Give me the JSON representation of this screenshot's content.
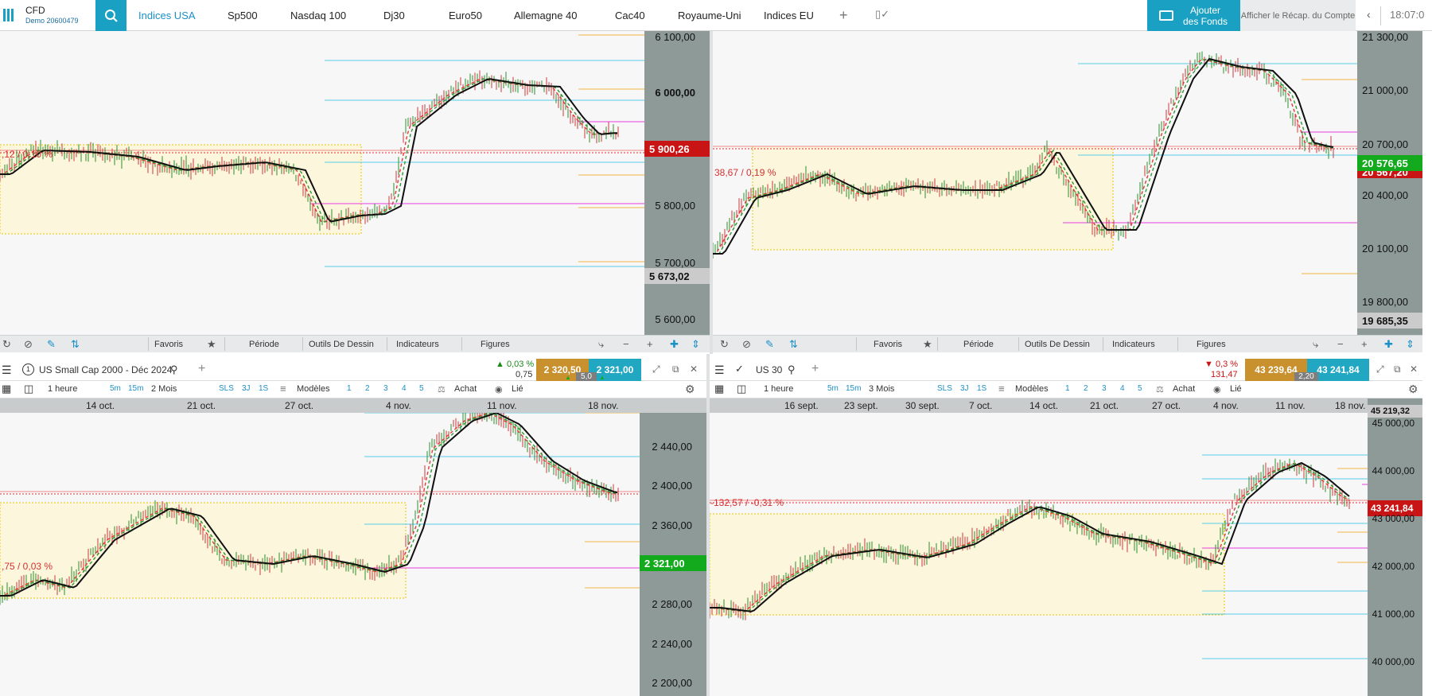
{
  "header": {
    "account_type": "CFD",
    "account_number": "Demo 20600479",
    "tabs": [
      "Indices USA",
      "Sp500",
      "Nasdaq 100",
      "Dj30",
      "Euro50",
      "Allemagne 40",
      "Cac40",
      "Royaume-Uni",
      "Indices EU"
    ],
    "add_funds_line1": "Ajouter",
    "add_funds_line2": "des Fonds",
    "account_summary": "Afficher le Récap. du Compte",
    "clock": "18:07:0"
  },
  "toolbar": {
    "favoris": "Favoris",
    "periode": "Période",
    "outils": "Outils De Dessin",
    "indicateurs": "Indicateurs",
    "figures": "Figures"
  },
  "charts": {
    "sp500": {
      "y_labels": [
        "6 100,00",
        "6 000,00",
        "5 800,00",
        "5 700,00",
        "5 600,00"
      ],
      "last_price": "5 900,26",
      "low_price": "5 673,02",
      "change_label": ",12 / 0,10 %"
    },
    "dj_top": {
      "y_labels": [
        "21 300,00",
        "21 000,00",
        "20 700,00",
        "20 400,00",
        "20 100,00",
        "19 800,00"
      ],
      "last_price": "20 576,65",
      "hidden_price": "20 567,20",
      "low_price": "19 685,35",
      "change_label": "38,67 / 0,19 %"
    },
    "russell": {
      "title": "US Small Cap 2000 - Déc 2024",
      "change_pct": "0,03 %",
      "change_abs": "0,75",
      "sell": "2 320,50",
      "buy": "2 321,00",
      "spread": "5,0",
      "timeframe": "1 heure",
      "period": "2 Mois",
      "modeles": "Modèles",
      "achat": "Achat",
      "lie": "Lié",
      "tf_buttons": [
        "5m",
        "15m"
      ],
      "range_buttons": [
        "SLS",
        "3J",
        "1S"
      ],
      "num_buttons": [
        "1",
        "2",
        "3",
        "4",
        "5"
      ],
      "dates": [
        "14 oct.",
        "21 oct.",
        "27 oct.",
        "4 nov.",
        "11 nov.",
        "18 nov."
      ],
      "y_labels": [
        "2 440,00",
        "2 400,00",
        "2 360,00",
        "2 280,00",
        "2 240,00",
        "2 200,00"
      ],
      "last_price": "2 321,00",
      "change_label": ",75 / 0,03 %"
    },
    "us30": {
      "title": "US 30",
      "change_pct": "0,3 %",
      "change_abs": "131,47",
      "sell": "43 239,64",
      "buy": "43 241,84",
      "spread": "2,20",
      "timeframe": "1 heure",
      "period": "3 Mois",
      "modeles": "Modèles",
      "achat": "Achat",
      "lie": "Lié",
      "tf_buttons": [
        "5m",
        "15m"
      ],
      "range_buttons": [
        "SLS",
        "3J",
        "1S"
      ],
      "num_buttons": [
        "1",
        "2",
        "3",
        "4",
        "5"
      ],
      "dates": [
        "16 sept.",
        "23 sept.",
        "30 sept.",
        "7 oct.",
        "14 oct.",
        "21 oct.",
        "27 oct.",
        "4 nov.",
        "11 nov.",
        "18 nov."
      ],
      "y_labels": [
        "45 219,32",
        "45 000,00",
        "44 000,00",
        "43 000,00",
        "42 000,00",
        "41 000,00",
        "40 000,00"
      ],
      "last_price": "43 241,84",
      "change_label": "-132,57 / -0,31 %"
    }
  },
  "colors": {
    "accent": "#1aa0c2",
    "red": "#c81414",
    "green": "#13aa1d",
    "axis_bg": "#8e9a97",
    "sell": "#c9902e",
    "buy": "#22a7c3"
  }
}
